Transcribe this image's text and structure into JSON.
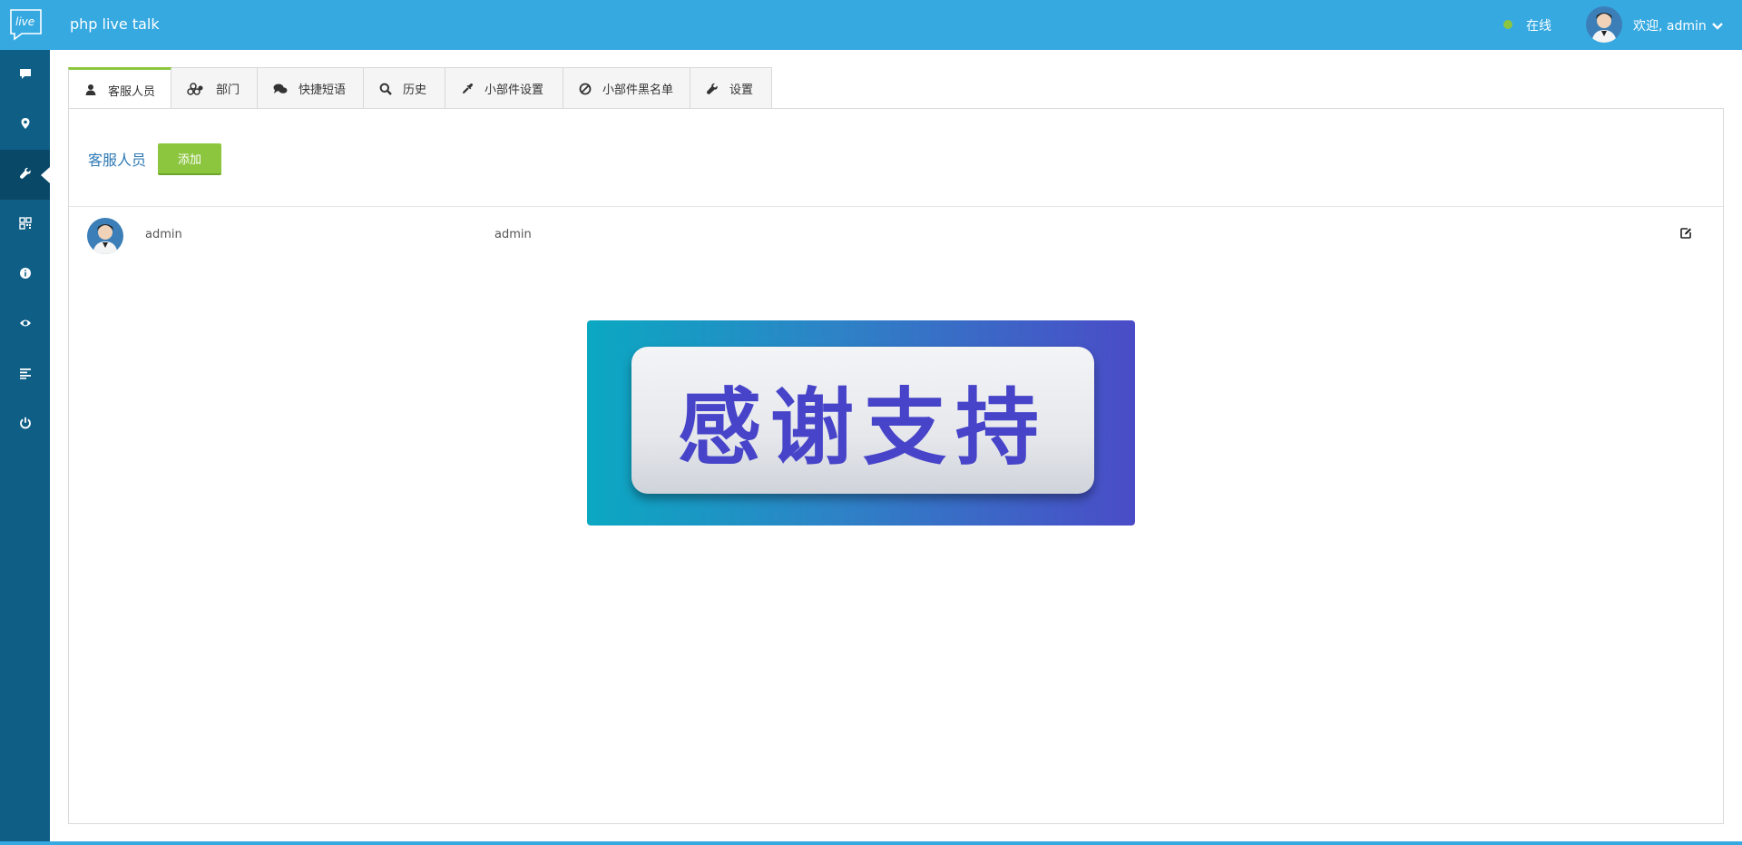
{
  "app": {
    "title": "php live talk",
    "logo_text": "live"
  },
  "header": {
    "status_text": "在线",
    "welcome_text": "欢迎, admin",
    "status_color": "#8cc63f"
  },
  "sidebar": {
    "items": [
      {
        "icon": "chat-icon",
        "active": false
      },
      {
        "icon": "location-icon",
        "active": false
      },
      {
        "icon": "wrench-icon",
        "active": true
      },
      {
        "icon": "qrcode-icon",
        "active": false
      },
      {
        "icon": "info-icon",
        "active": false
      },
      {
        "icon": "eye-icon",
        "active": false
      },
      {
        "icon": "list-icon",
        "active": false
      },
      {
        "icon": "power-icon",
        "active": false
      }
    ]
  },
  "tabs": [
    {
      "label": "客服人员",
      "icon": "user-icon",
      "active": true
    },
    {
      "label": "部门",
      "icon": "groups-icon",
      "active": false
    },
    {
      "label": "快捷短语",
      "icon": "comments-icon",
      "active": false
    },
    {
      "label": "历史",
      "icon": "search-icon",
      "active": false
    },
    {
      "label": "小部件设置",
      "icon": "eyedropper-icon",
      "active": false
    },
    {
      "label": "小部件黑名单",
      "icon": "ban-icon",
      "active": false
    },
    {
      "label": "设置",
      "icon": "wrench-icon",
      "active": false
    }
  ],
  "panel": {
    "section_title": "客服人员",
    "add_label": "添加",
    "rows": [
      {
        "name": "admin",
        "account": "admin"
      }
    ]
  },
  "banner": {
    "text": "感谢支持"
  },
  "colors": {
    "topbar": "#36a9e1",
    "sidebar": "#0f5e86",
    "accent_green": "#8cc63f",
    "link_blue": "#2f7ab5",
    "banner_text": "#4744c9"
  }
}
